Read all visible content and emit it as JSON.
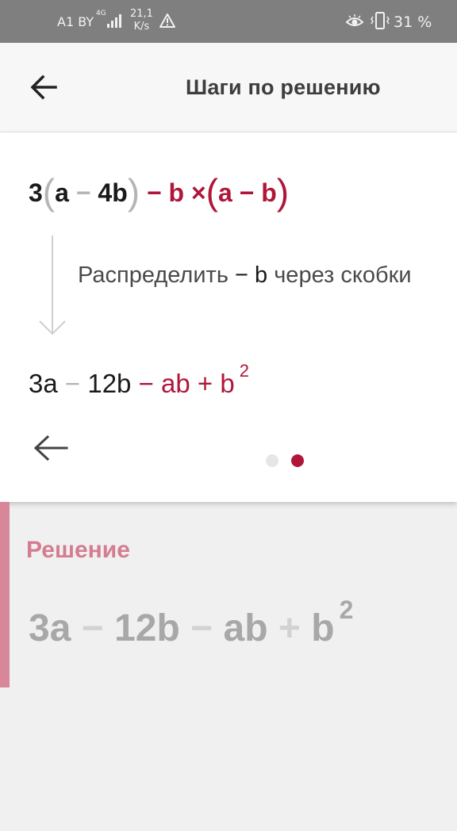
{
  "status_bar": {
    "carrier": "A1 BY",
    "network": "4G",
    "speed_value": "21,1",
    "speed_unit": "K/s",
    "battery": "31 %"
  },
  "app_bar": {
    "title": "Шаги по решению",
    "back_icon": "arrow-left-icon"
  },
  "step": {
    "expression_top": {
      "t1": "3",
      "lp1": "(",
      "t2": "a",
      "op1": "−",
      "t3": "4b",
      "rp1": ")",
      "op2": "−",
      "t4": "b",
      "op3": "×",
      "lp2": "(",
      "t5": "a",
      "op4": "−",
      "t6": "b",
      "rp2": ")"
    },
    "description": {
      "prefix": "Распределить",
      "op": "−",
      "var": "b",
      "suffix": "через скобки"
    },
    "result": {
      "t1": "3a",
      "op1": "−",
      "t2": "12b",
      "op2": "−",
      "t3": "ab",
      "op3": "+",
      "t4": "b",
      "exp": "2"
    },
    "pager": {
      "current": 2,
      "total": 2
    }
  },
  "solution": {
    "title": "Решение",
    "expression": {
      "t1": "3a",
      "op1": "−",
      "t2": "12b",
      "op2": "−",
      "t3": "ab",
      "op3": "+",
      "t4": "b",
      "exp": "2"
    }
  },
  "colors": {
    "accent": "#b0163a",
    "solution_accent": "#d78799",
    "status_bar_bg": "#7f7f7f"
  }
}
